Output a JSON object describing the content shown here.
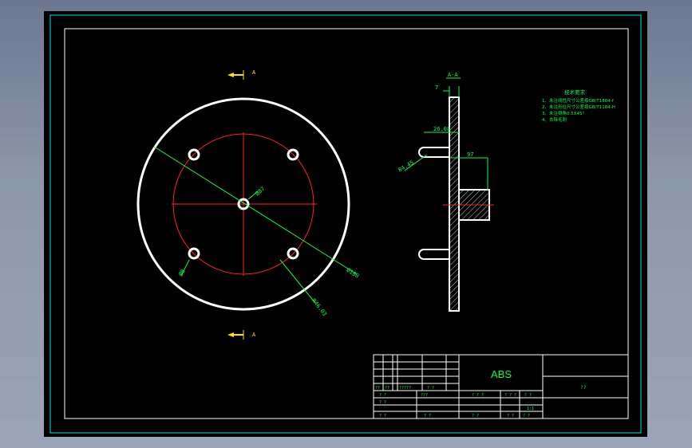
{
  "drawing": {
    "section_marker_top": "A",
    "section_marker_bottom": "A",
    "section_view_label": "A-A",
    "dim_hole_circle": "Ø87",
    "dim_outer_diameter": "Ø180",
    "dim_hole_diameter": "Ø8",
    "dim_radius": "R46.03",
    "dim_thickness": "7",
    "dim_boss_length": "26.08",
    "dim_boss_width": "97",
    "dim_angle": "84.45",
    "notes_title": "技术要求",
    "notes": [
      "1、未注线性尺寸公差按GB/T1804-f",
      "2、未注形位尺寸公差按GB/T1184-H",
      "3、未注倒角0.5X45°",
      "4、去除毛刺"
    ]
  },
  "title_block": {
    "material": "ABS",
    "drawing_code": "??",
    "cells": {
      "r1a": "??",
      "r1b": "??",
      "r1c": "?????",
      "r1d": "? ?",
      "r2a": "? ?",
      "r2b": "???",
      "r3a": "? ?",
      "r4a": "? ?",
      "r4b": "? ?",
      "mid_a": "? ? ?",
      "mid_b": "? ? ?",
      "mid_c": "? ?",
      "mid_d": "? ?",
      "mid_scale": "1:1",
      "bot_a": "? ?",
      "bot_b": "? ?"
    }
  },
  "colors": {
    "background": "#000000",
    "frame_cyan": "#00e5e5",
    "border_white": "#ffffff",
    "centerline_red": "#ff2020",
    "dimension_green": "#00ff4c",
    "marker_yellow": "#ffe000"
  }
}
